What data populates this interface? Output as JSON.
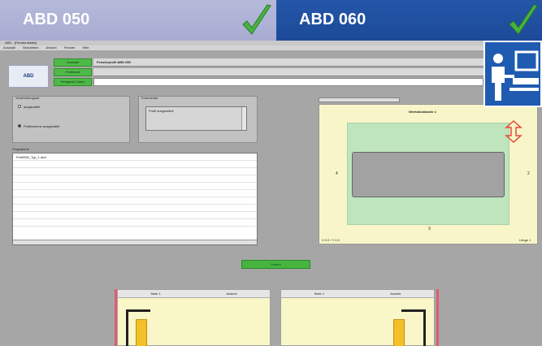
{
  "banners": {
    "left_title": "ABD 050",
    "right_title": "ABD 060"
  },
  "colors": {
    "check": "#47b43f",
    "banner_right": "#1c4a98",
    "banner_left": "#a8acd2",
    "button_green": "#4fb948"
  },
  "icons": [
    "check-icon",
    "check-icon",
    "operator-computer-icon",
    "arrow-icon"
  ],
  "window": {
    "title": "ABD - [Fensterdetails]",
    "menu": [
      "Auswahl",
      "Bearbeiten",
      "Ansicht",
      "Fenster",
      "Hilfe"
    ],
    "logo": "ABD",
    "green_buttons": [
      "Auswahl",
      "Profilmaß",
      "Fertigmaß Nutze"
    ],
    "top_label": "Fensterprofil ABD 050",
    "left_options_group": "Verarbeitungsart",
    "option1": "ausgewählt",
    "option2": "Profilschiene ausgewählt",
    "comment_group": "Kommentar",
    "comment_text": "Profil ausgewählt",
    "list_group": "Programme",
    "list_item": "Profil060_Typ_1.abd",
    "drawing_title": "Werkstückkante 1",
    "dim_left": "4",
    "dim_right": "2",
    "dim_bottom": "3",
    "coords_left": "X 0.0 / Y 0.0",
    "coords_right": "Länge 1",
    "ok_button": "Starten",
    "lower_left_headers": [
      "Seite 1",
      "Ansicht"
    ],
    "lower_right_headers": [
      "Seite 1",
      "Ansicht"
    ]
  }
}
